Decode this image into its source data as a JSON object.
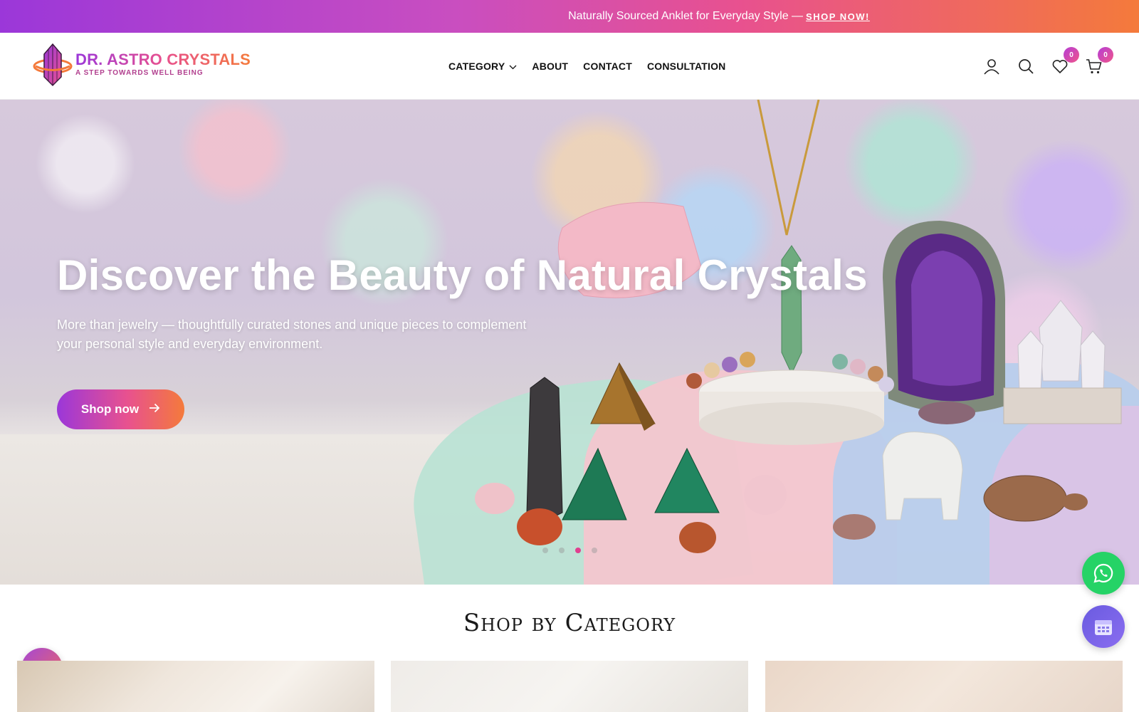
{
  "announcement": {
    "text": "Naturally Sourced Anklet for Everyday Style —",
    "link_label": "SHOP NOW!"
  },
  "brand": {
    "name": "DR. ASTRO CRYSTALS",
    "tagline": "A STEP TOWARDS WELL BEING",
    "logo_icon": "crystal-planet-logo"
  },
  "nav": {
    "items": [
      {
        "label": "CATEGORY",
        "has_dropdown": true
      },
      {
        "label": "ABOUT"
      },
      {
        "label": "CONTACT"
      },
      {
        "label": "CONSULTATION"
      }
    ]
  },
  "header_icons": {
    "account": "user-icon",
    "search": "search-icon",
    "wishlist": "heart-icon",
    "wishlist_count": "0",
    "cart": "cart-icon",
    "cart_count": "0"
  },
  "hero": {
    "title": "Discover the Beauty of Natural Crystals",
    "subtitle": "More than jewelry — thoughtfully curated stones and unique pieces to complement your personal style and everyday environment.",
    "button_label": "Shop now",
    "slides": 4,
    "active_slide": 3
  },
  "section": {
    "title": "Shop by Category"
  },
  "floating": {
    "whatsapp": "whatsapp-icon",
    "calendar": "calendar-icon",
    "gem": "gem-icon"
  },
  "colors": {
    "gradient_start": "#9b37d9",
    "gradient_mid": "#e8518f",
    "gradient_end": "#f47a3b",
    "whatsapp": "#25d366",
    "active_dot": "#e0408f"
  }
}
